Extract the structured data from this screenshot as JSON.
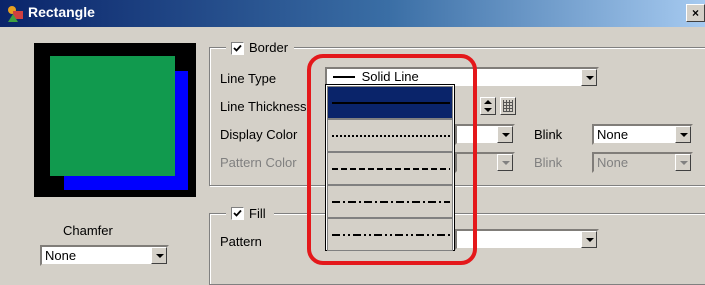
{
  "window": {
    "title": "Rectangle",
    "icon": "shapes-icon",
    "close_label": "×"
  },
  "border": {
    "checkbox_label": "Border",
    "checked": true,
    "line_type_label": "Line Type",
    "line_type_value": "Solid Line",
    "line_thickness_label": "Line Thickness",
    "display_color_label": "Display Color",
    "pattern_color_label": "Pattern Color",
    "blink_label": "Blink",
    "blink_value": "None",
    "pattern_blink_label": "Blink",
    "pattern_blink_value": "None",
    "line_options": [
      "Solid Line",
      "Dotted Line",
      "Dashed Line",
      "Dash-Dot Line",
      "Dash-Dot-Dot Line"
    ]
  },
  "fill": {
    "checkbox_label": "Fill",
    "checked": true,
    "pattern_label": "Pattern"
  },
  "chamfer": {
    "label": "Chamfer",
    "value": "None"
  },
  "colors": {
    "preview_fill": "#119a4e",
    "preview_shadow": "#0000ff",
    "highlight": "#e4181b",
    "selection": "#0a246a"
  }
}
